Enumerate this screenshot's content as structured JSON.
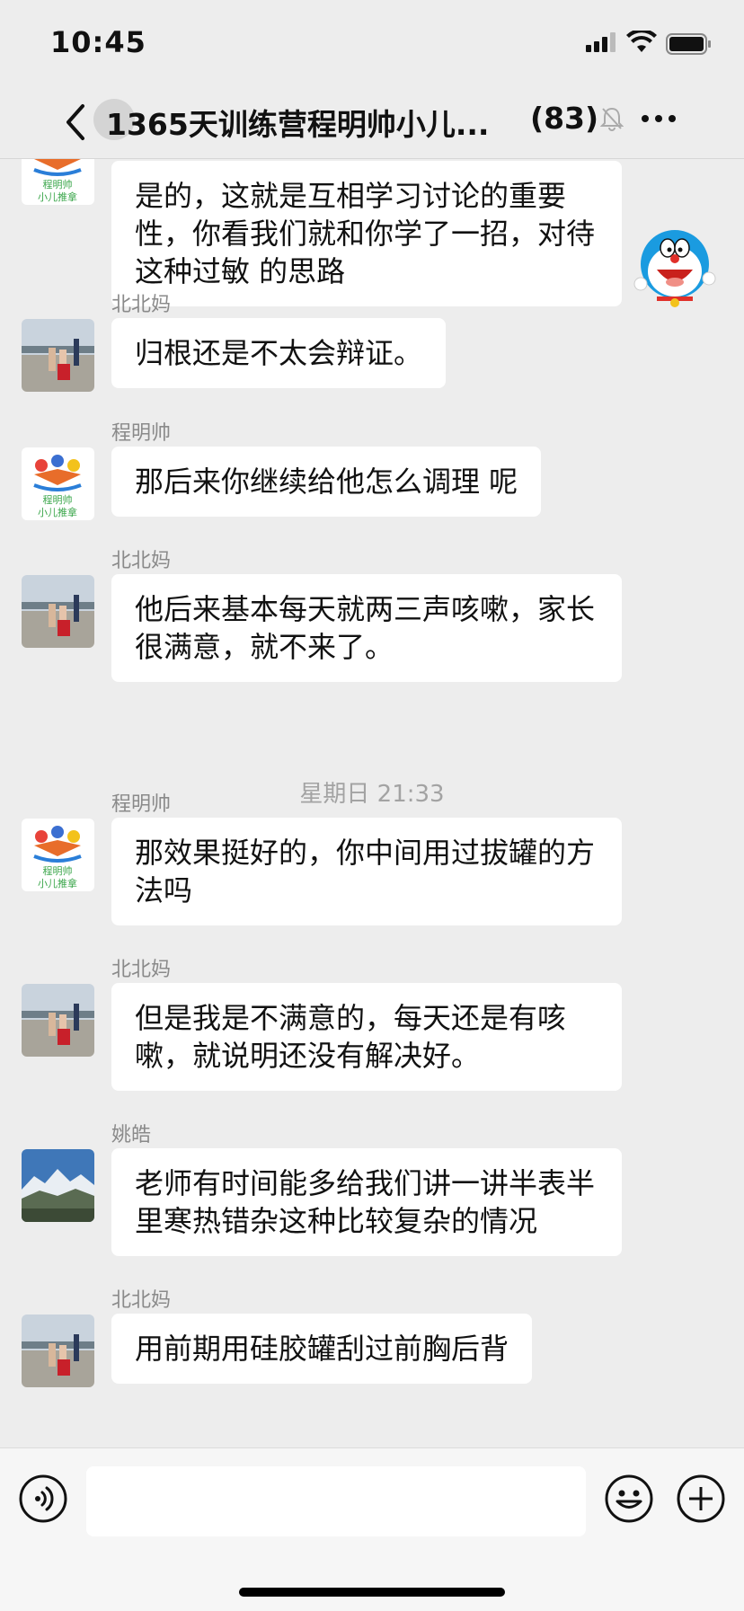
{
  "status_bar": {
    "time": "10:45"
  },
  "header": {
    "title": "1365天训练营程明帅小儿...",
    "member_count": "(83)",
    "muted_icon": "bell-slash-icon",
    "more_icon": "more-dots-icon"
  },
  "messages": [
    {
      "sender": "",
      "avatar": "cmsh-logo",
      "text": "是的，这就是互相学习讨论的重要性，你看我们就和你学了一招，对待这种过敏 的思路"
    },
    {
      "sender": "北北妈",
      "avatar": "beibeima-photo",
      "text": "归根还是不太会辩证。"
    },
    {
      "sender": "程明帅",
      "avatar": "cmsh-logo",
      "text": "那后来你继续给他怎么调理 呢"
    },
    {
      "sender": "北北妈",
      "avatar": "beibeima-photo",
      "text": "他后来基本每天就两三声咳嗽，家长很满意，就不来了。"
    },
    {
      "sender": "程明帅",
      "avatar": "cmsh-logo",
      "text": "那效果挺好的，你中间用过拔罐的方法吗"
    },
    {
      "sender": "北北妈",
      "avatar": "beibeima-photo",
      "text": "但是我是不满意的，每天还是有咳嗽，就说明还没有解决好。"
    },
    {
      "sender": "姚皓",
      "avatar": "mountain-photo",
      "text": "老师有时间能多给我们讲一讲半表半里寒热错杂这种比较复杂的情况"
    },
    {
      "sender": "北北妈",
      "avatar": "beibeima-photo",
      "text": "用前期用硅胶罐刮过前胸后背"
    }
  ],
  "timestamp_divider": "星期日 21:33",
  "logo": {
    "line1": "程明帅",
    "line2": "小儿推拿"
  },
  "colors": {
    "background": "#ededed",
    "bubble": "#ffffff",
    "name": "#8a8a8a",
    "logo_green": "#3aa64a"
  }
}
